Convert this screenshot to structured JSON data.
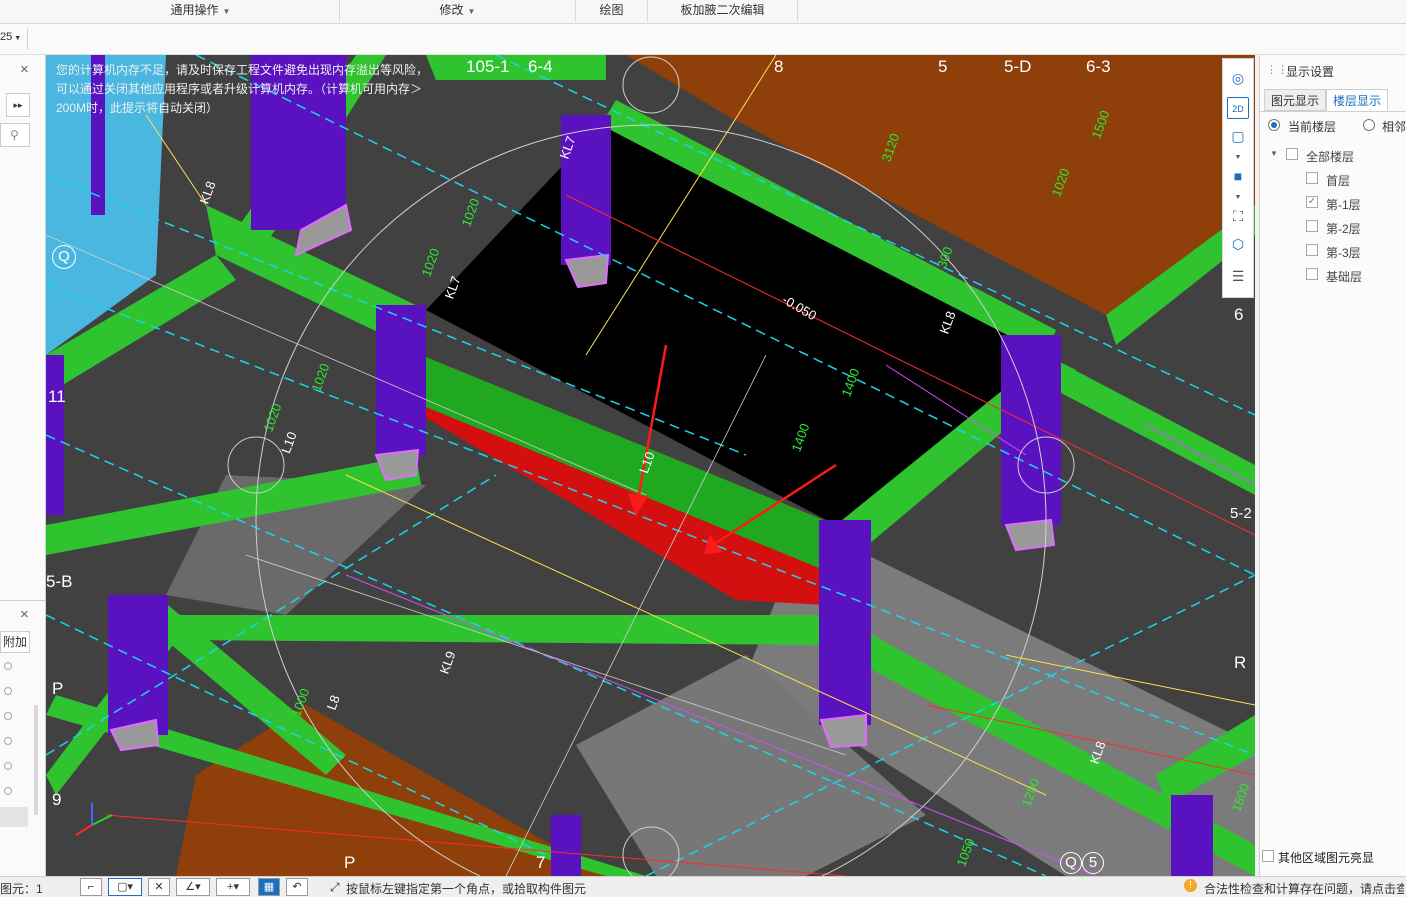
{
  "ribbon": {
    "groups": [
      {
        "label": "通用操作",
        "has_caret": true
      },
      {
        "label": "修改",
        "has_caret": true
      },
      {
        "label": "绘图",
        "has_caret": false
      },
      {
        "label": "板加腋二次编辑",
        "has_caret": false
      }
    ]
  },
  "subbar": {
    "zoom_value": "25"
  },
  "left_panel": {
    "fold_tab_label": "附加"
  },
  "viewport": {
    "warning_text": "您的计算机内存不足，请及时保存工程文件避免出现内存溢出等风险，可以通过关闭其他应用程序或者升级计算机内存。（计算机可用内存＞200M时，此提示将自动关闭）",
    "axis_labels": [
      "105-1",
      "6-4",
      "8",
      "5",
      "5-D",
      "6-3",
      "Q",
      "11",
      "6",
      "5-B",
      "R",
      "P",
      "9",
      "P",
      "7",
      "Q",
      "5",
      "5-2"
    ],
    "dim_labels": [
      "3120",
      "1020",
      "1020",
      "1020",
      "1020",
      "300",
      "1400",
      "1400",
      "1000",
      "1200",
      "1020",
      "1050",
      "1800",
      "1500",
      "-0.050"
    ],
    "beam_labels": [
      "KL7",
      "KL7",
      "L10",
      "L10",
      "KL8",
      "KL8",
      "KL8",
      "L8",
      "KL9"
    ]
  },
  "right_panel": {
    "header": "显示设置",
    "tabs": [
      "图元显示",
      "楼层显示"
    ],
    "active_tab": 1,
    "radio_current": "当前楼层",
    "radio_adjacent": "相邻",
    "tree_root": "全部楼层",
    "floors": [
      {
        "label": "首层",
        "checked": false
      },
      {
        "label": "第-1层",
        "checked": true
      },
      {
        "label": "第-2层",
        "checked": false
      },
      {
        "label": "第-3层",
        "checked": false
      },
      {
        "label": "基础层",
        "checked": false
      }
    ],
    "bottom_checkbox": "其他区域图元亮显"
  },
  "statusbar": {
    "left_text": "图元：1",
    "prompt": "按鼠标左键指定第一个角点，或拾取构件图元",
    "alert": "合法性检查和计算存在问题，请点击查看"
  },
  "colors": {
    "beam_green": "#2fc42f",
    "column_purple": "#5a12c0",
    "slab_brown": "#8f3f0a",
    "slab_black": "#000000",
    "slab_cyan": "#49b7e0",
    "selected_red": "#d40f0f",
    "accent_blue": "#1a6fc0"
  }
}
